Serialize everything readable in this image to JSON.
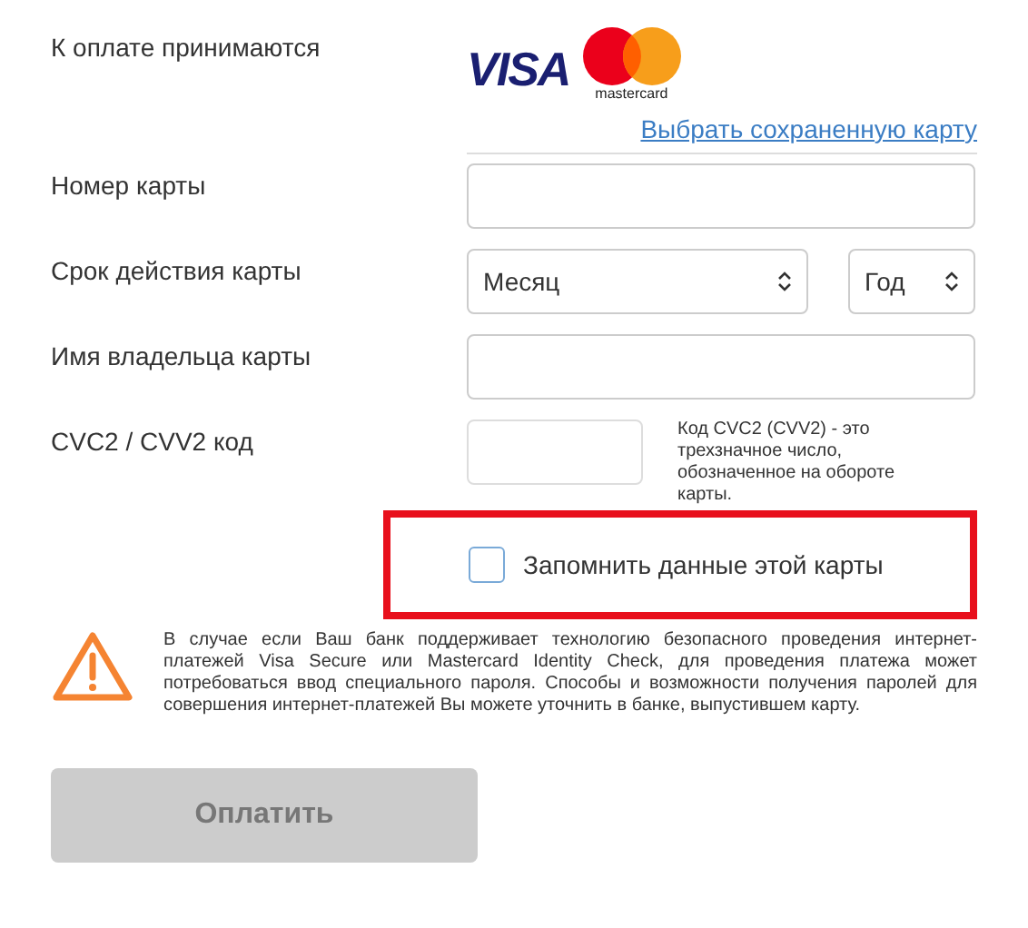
{
  "accepted": {
    "label": "К оплате принимаются",
    "visa_logo": "VISA",
    "mastercard_logo": "mastercard"
  },
  "saved_card_link": "Выбрать сохраненную карту",
  "fields": [
    {
      "kind": "text",
      "label": "Номер карты"
    },
    {
      "kind": "expiry",
      "label": "Срок действия карты",
      "month": "Месяц",
      "year": "Год"
    },
    {
      "kind": "text",
      "label": "Имя владельца карты"
    },
    {
      "kind": "cvc",
      "label": "CVC2 / CVV2 код",
      "hint": "Код CVC2 (CVV2) - это трехзначное число, обозначенное на обороте карты."
    }
  ],
  "remember_card": {
    "label": "Запомнить данные этой карты",
    "checked": false
  },
  "notice": "В случае если Ваш банк поддерживает технологию безопасного проведения интернет-платежей Visa Secure или Mastercard Identity Check, для проведения платежа может потребоваться ввод специального пароля. Способы и возможности получения паролей для совершения интернет-платежей Вы можете уточнить в банке, выпустившем карту.",
  "pay_button": {
    "label": "Оплатить",
    "disabled": true
  }
}
